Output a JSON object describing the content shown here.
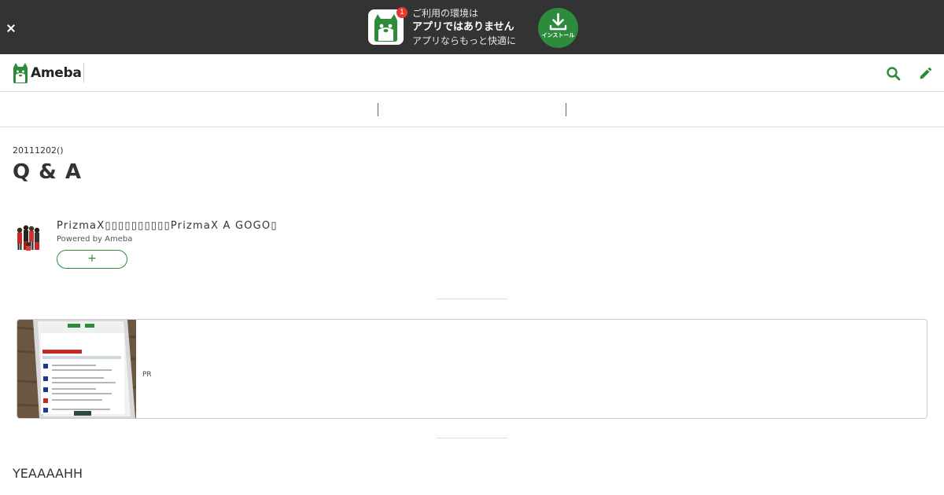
{
  "promo": {
    "badge_count": "1",
    "line1": "ご利用の環境は",
    "line2": "アプリではありません",
    "line3": "アプリならもっと快適に",
    "install_label": "インストール",
    "install_color": "#2d8c3c"
  },
  "header": {
    "logo_text": "Ameba",
    "brand_color": "#2d8c3c"
  },
  "article": {
    "date": "20111202()",
    "title": "Q & A",
    "author_name": "PrizmaX▯▯▯▯▯▯▯▯▯▯PrizmaX A GOGO▯",
    "powered_by": "Powered by Ameba",
    "follow_label": "+",
    "ad_label": "PR",
    "body_text": "YEAAAAHH"
  }
}
